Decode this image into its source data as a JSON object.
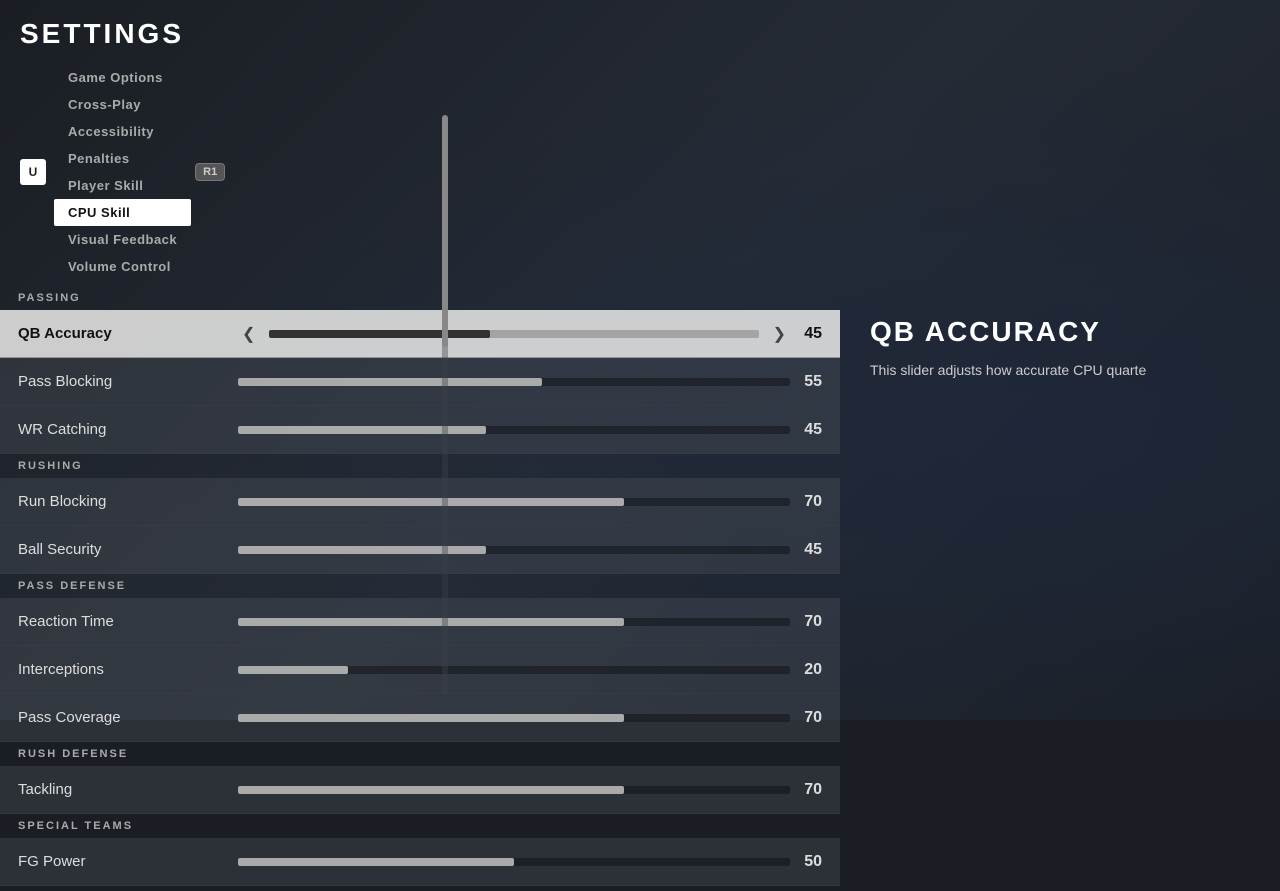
{
  "page": {
    "title": "SETTINGS"
  },
  "nav": {
    "icon_label": "U",
    "tabs": [
      {
        "id": "game-options",
        "label": "Game Options",
        "active": false
      },
      {
        "id": "cross-play",
        "label": "Cross-Play",
        "active": false
      },
      {
        "id": "accessibility",
        "label": "Accessibility",
        "active": false
      },
      {
        "id": "penalties",
        "label": "Penalties",
        "active": false
      },
      {
        "id": "player-skill",
        "label": "Player Skill",
        "active": false
      },
      {
        "id": "cpu-skill",
        "label": "CPU Skill",
        "active": true
      },
      {
        "id": "visual-feedback",
        "label": "Visual Feedback",
        "active": false
      },
      {
        "id": "volume-control",
        "label": "Volume Control",
        "active": false
      }
    ],
    "r1_label": "R1"
  },
  "sections": [
    {
      "id": "passing",
      "header": "PASSING",
      "items": [
        {
          "id": "qb-accuracy",
          "label": "QB Accuracy",
          "value": 45,
          "fill_pct": 45,
          "active": true
        },
        {
          "id": "pass-blocking",
          "label": "Pass Blocking",
          "value": 55,
          "fill_pct": 55,
          "active": false
        },
        {
          "id": "wr-catching",
          "label": "WR Catching",
          "value": 45,
          "fill_pct": 45,
          "active": false
        }
      ]
    },
    {
      "id": "rushing",
      "header": "RUSHING",
      "items": [
        {
          "id": "run-blocking",
          "label": "Run Blocking",
          "value": 70,
          "fill_pct": 70,
          "active": false
        },
        {
          "id": "ball-security",
          "label": "Ball Security",
          "value": 45,
          "fill_pct": 45,
          "active": false
        }
      ]
    },
    {
      "id": "pass-defense",
      "header": "PASS DEFENSE",
      "items": [
        {
          "id": "reaction-time",
          "label": "Reaction Time",
          "value": 70,
          "fill_pct": 70,
          "active": false
        },
        {
          "id": "interceptions",
          "label": "Interceptions",
          "value": 20,
          "fill_pct": 20,
          "active": false
        },
        {
          "id": "pass-coverage",
          "label": "Pass Coverage",
          "value": 70,
          "fill_pct": 70,
          "active": false
        }
      ]
    },
    {
      "id": "rush-defense",
      "header": "RUSH DEFENSE",
      "items": [
        {
          "id": "tackling",
          "label": "Tackling",
          "value": 70,
          "fill_pct": 70,
          "active": false
        }
      ]
    },
    {
      "id": "special-teams",
      "header": "SPECIAL TEAMS",
      "items": [
        {
          "id": "fg-power",
          "label": "FG Power",
          "value": 50,
          "fill_pct": 50,
          "active": false
        }
      ]
    }
  ],
  "description": {
    "title": "QB ACCURACY",
    "text": "This slider adjusts how accurate CPU quarte"
  }
}
